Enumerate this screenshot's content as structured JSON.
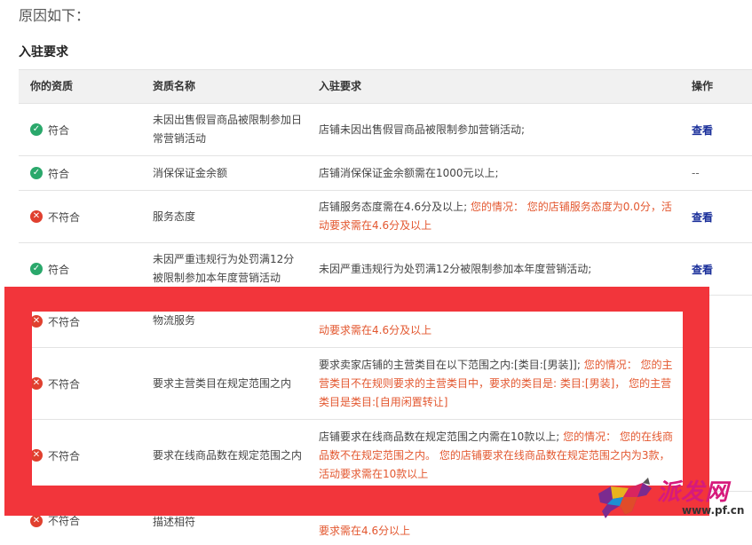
{
  "intro_text": "原因如下：",
  "section_title": "入驻要求",
  "table": {
    "headers": {
      "qualification": "你的资质",
      "name": "资质名称",
      "requirement": "入驻要求",
      "action": "操作"
    },
    "rows": [
      {
        "status": "符合",
        "name": "未因出售假冒商品被限制参加日常营销活动",
        "requirement": "店铺未因出售假冒商品被限制参加营销活动;",
        "detail": "",
        "action": "查看"
      },
      {
        "status": "符合",
        "name": "消保保证金余额",
        "requirement": "店铺消保保证金余额需在1000元以上;",
        "detail": "",
        "action": "--"
      },
      {
        "status": "不符合",
        "name": "服务态度",
        "requirement": "店铺服务态度需在4.6分及以上;",
        "detail": "您的情况： 您的店铺服务态度为0.0分，活动要求需在4.6分及以上",
        "action": "查看"
      },
      {
        "status": "符合",
        "name": "未因严重违规行为处罚满12分被限制参加本年度营销活动",
        "requirement": "未因严重违规行为处罚满12分被限制参加本年度营销活动;",
        "detail": "",
        "action": "查看"
      },
      {
        "status": "不符合",
        "name": "物流服务",
        "requirement": "",
        "detail": "动要求需在4.6分及以上",
        "action": ""
      },
      {
        "status": "不符合",
        "name": "要求主营类目在规定范围之内",
        "requirement": "要求卖家店铺的主营类目在以下范围之内:[类目:[男装]];",
        "detail": "您的情况： 您的主营类目不在规则要求的主营类目中，要求的类目是: 类目:[男装]， 您的主营类目是类目:[自用闲置转让]",
        "action": ""
      },
      {
        "status": "不符合",
        "name": "要求在线商品数在规定范围之内",
        "requirement": "店铺要求在线商品数在规定范围之内需在10款以上;",
        "detail": "您的情况： 您的在线商品数不在规定范围之内。 您的店铺要求在线商品数在规定范围之内为3款，活动要求需在10款以上",
        "action": ""
      },
      {
        "status": "不符合",
        "name": "描述相符",
        "requirement": "",
        "detail": "要求需在4.6分以上",
        "action": ""
      }
    ]
  },
  "watermark": {
    "brand": "派发网",
    "url": "www.pf.cn"
  },
  "colors": {
    "ok": "#2aa86b",
    "bad": "#e0402f",
    "highlight": "#f2353b",
    "link": "#1a2f9a",
    "warning_text": "#e3572f"
  }
}
